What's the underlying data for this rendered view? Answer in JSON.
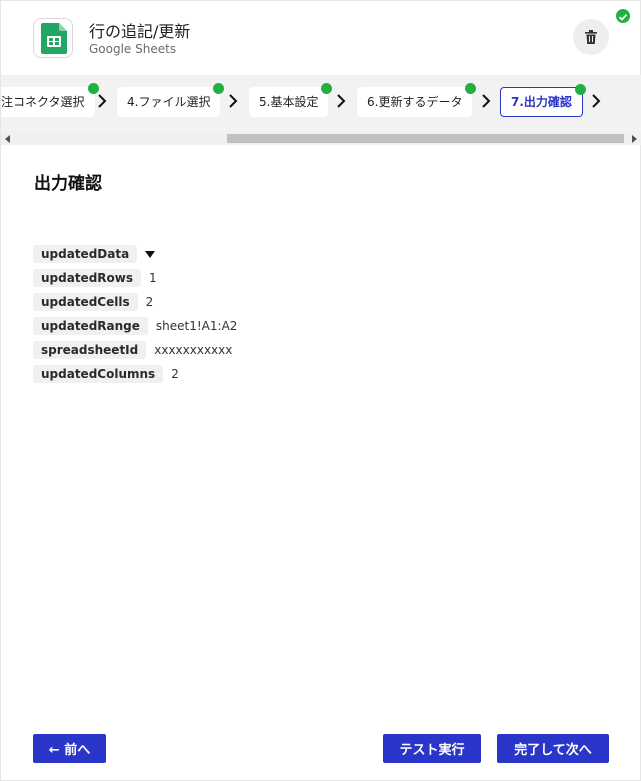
{
  "header": {
    "title": "行の追記/更新",
    "subtitle": "Google Sheets",
    "app_icon": "google-sheets-icon",
    "delete_icon": "trash-icon",
    "status_icon": "check-circle-icon"
  },
  "stepper": {
    "steps": [
      {
        "label": "注コネクタ選択",
        "done": true
      },
      {
        "label": "4.ファイル選択",
        "done": true
      },
      {
        "label": "5.基本設定",
        "done": true
      },
      {
        "label": "6.更新するデータ",
        "done": true
      },
      {
        "label": "7.出力確認",
        "done": true,
        "active": true
      }
    ]
  },
  "main": {
    "section_title": "出力確認",
    "output": [
      {
        "key": "updatedData",
        "value": ""
      },
      {
        "key": "updatedRows",
        "value": "1"
      },
      {
        "key": "updatedCells",
        "value": "2"
      },
      {
        "key": "updatedRange",
        "value": "sheet1!A1:A2"
      },
      {
        "key": "spreadsheetId",
        "value": "xxxxxxxxxxx"
      },
      {
        "key": "updatedColumns",
        "value": "2"
      }
    ]
  },
  "footer": {
    "back_label": "← 前へ",
    "test_label": "テスト実行",
    "next_label": "完了して次へ"
  },
  "colors": {
    "accent": "#2a35c9",
    "success": "#1fb141",
    "sheets_green": "#23a566"
  }
}
